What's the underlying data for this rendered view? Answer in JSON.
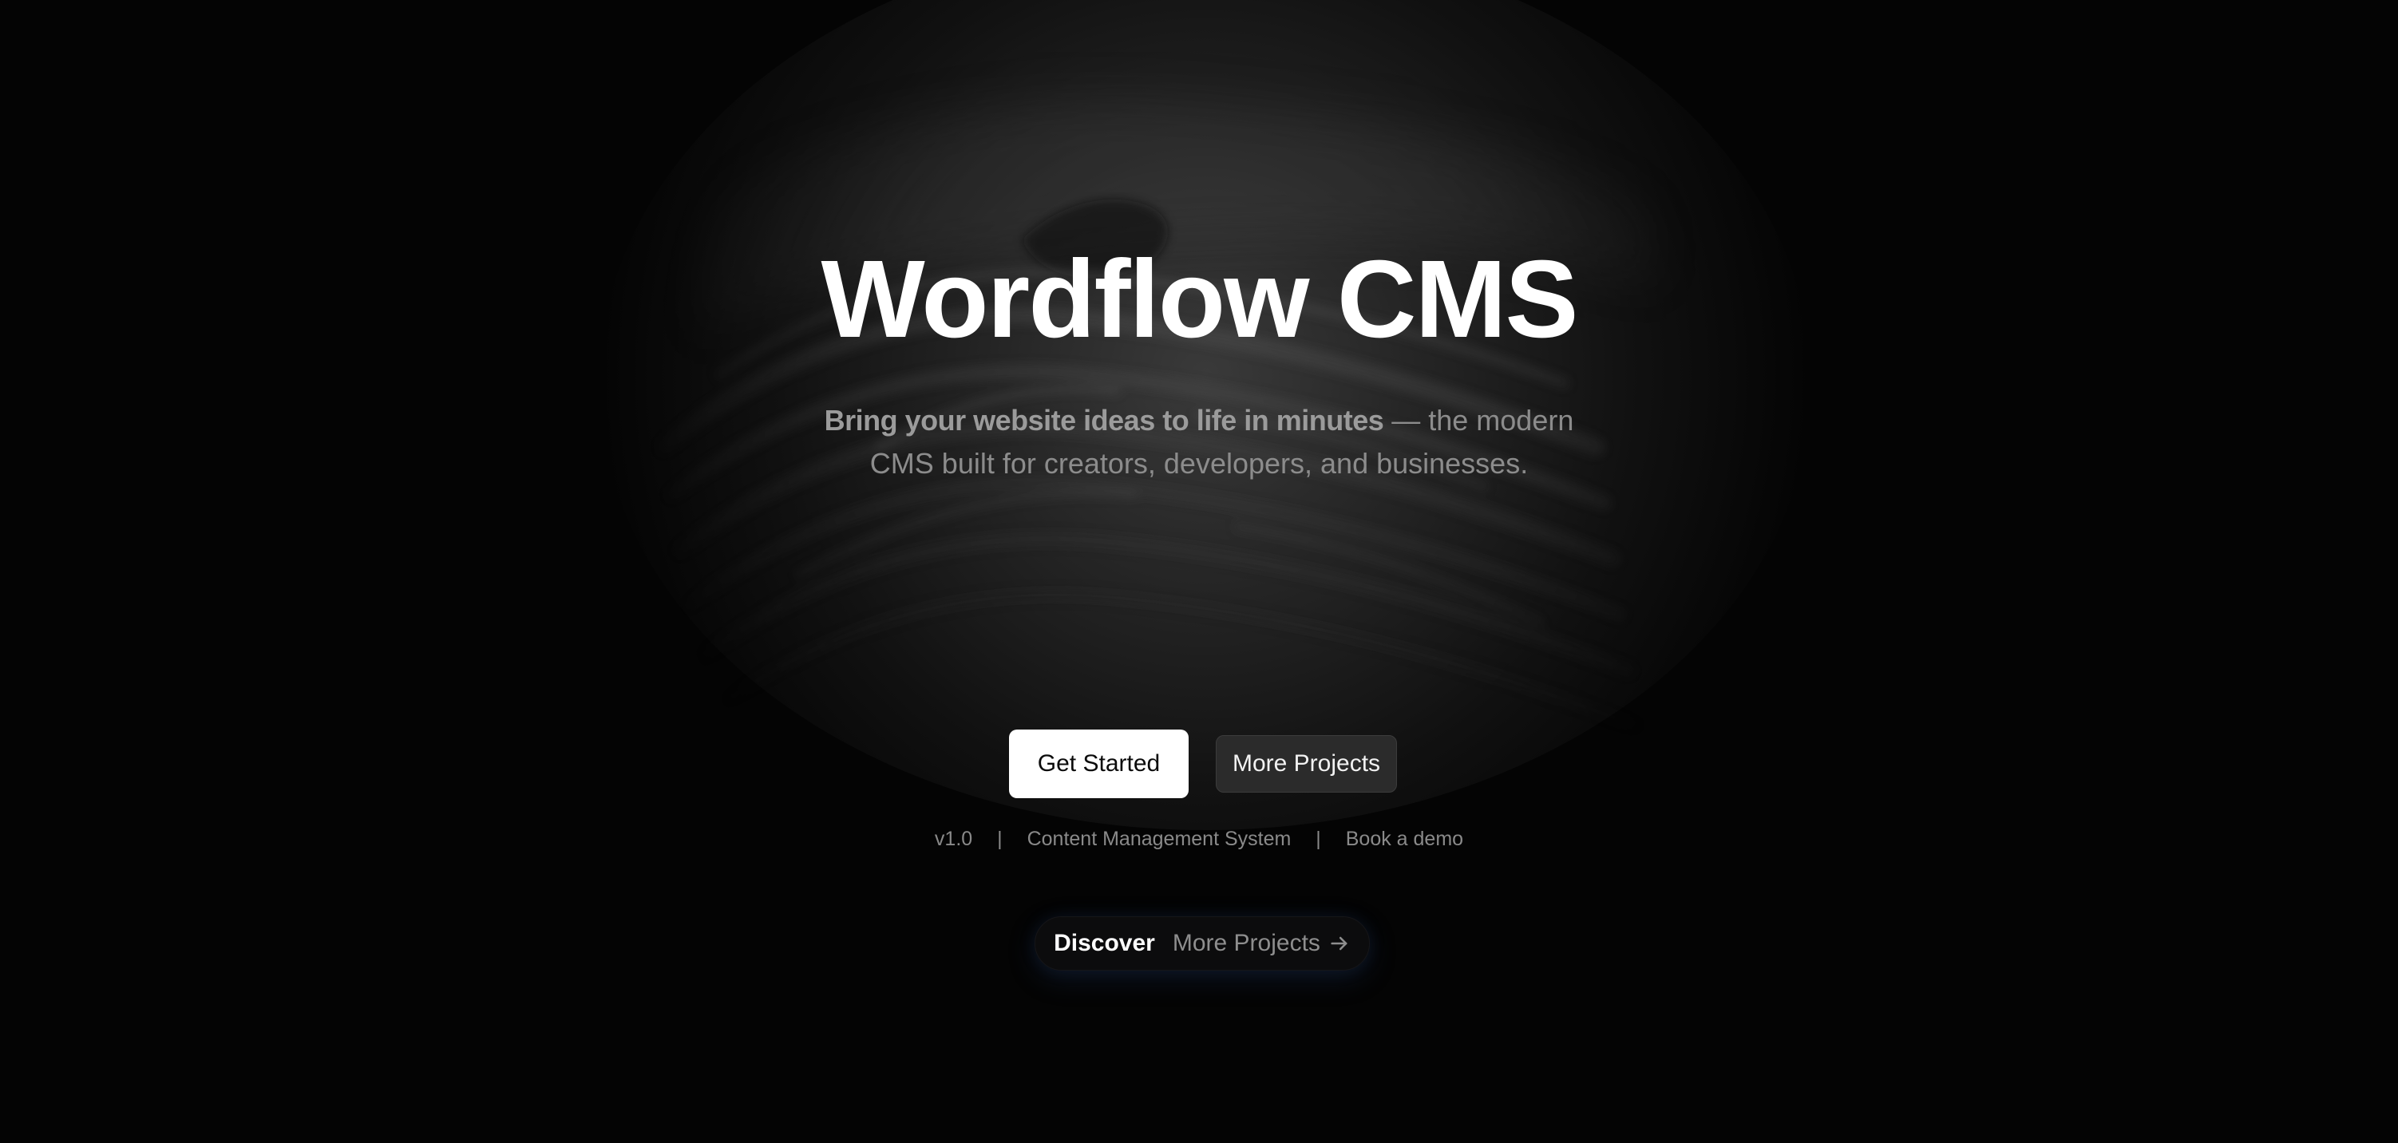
{
  "hero": {
    "title": "Wordflow CMS",
    "subtitle_strong": "Bring your website ideas to life in minutes",
    "subtitle_rest": " — the modern CMS built for creators, developers, and businesses."
  },
  "actions": {
    "primary_label": "Get Started",
    "secondary_label": "More Projects"
  },
  "meta": {
    "version": "v1.0",
    "separator": "|",
    "product": "Content Management System",
    "demo_link": "Book a demo"
  },
  "discover": {
    "label": "Discover",
    "link_label": "More Projects",
    "icon": "arrow-right-icon"
  },
  "colors": {
    "background": "#040404",
    "title": "#ffffff",
    "primary_button_bg": "#ffffff",
    "secondary_button_bg": "#2b2b2b",
    "muted_text": "#8a8a8a"
  }
}
